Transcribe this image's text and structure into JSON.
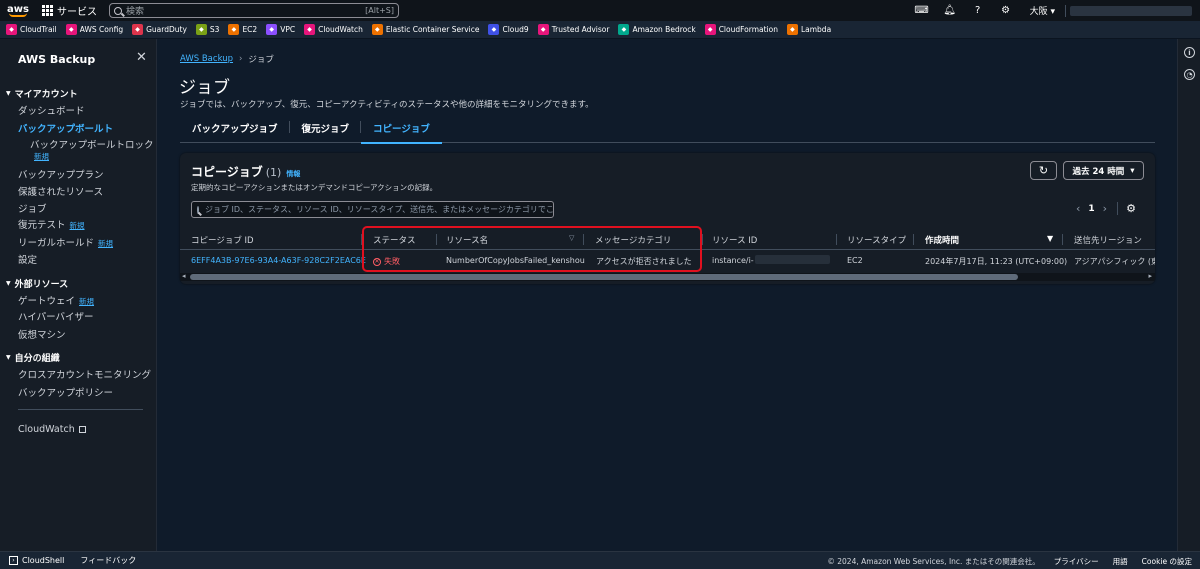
{
  "topnav": {
    "logo": "aws",
    "services_label": "サービス",
    "search_placeholder": "検索",
    "search_shortcut": "[Alt+S]",
    "region": "大阪 ▾"
  },
  "favorites": [
    {
      "label": "CloudTrail",
      "color": "#e7157b",
      "icon": "cloudtrail-icon"
    },
    {
      "label": "AWS Config",
      "color": "#e7157b",
      "icon": "config-icon"
    },
    {
      "label": "GuardDuty",
      "color": "#dd344c",
      "icon": "guardduty-icon"
    },
    {
      "label": "S3",
      "color": "#7aa116",
      "icon": "s3-icon"
    },
    {
      "label": "EC2",
      "color": "#ed7100",
      "icon": "ec2-icon"
    },
    {
      "label": "VPC",
      "color": "#8c4fff",
      "icon": "vpc-icon"
    },
    {
      "label": "CloudWatch",
      "color": "#e7157b",
      "icon": "cloudwatch-icon"
    },
    {
      "label": "Elastic Container Service",
      "color": "#ed7100",
      "icon": "ecs-icon"
    },
    {
      "label": "Cloud9",
      "color": "#3f51e6",
      "icon": "cloud9-icon"
    },
    {
      "label": "Trusted Advisor",
      "color": "#e7157b",
      "icon": "trusted-advisor-icon"
    },
    {
      "label": "Amazon Bedrock",
      "color": "#01a88d",
      "icon": "bedrock-icon"
    },
    {
      "label": "CloudFormation",
      "color": "#e7157b",
      "icon": "cloudformation-icon"
    },
    {
      "label": "Lambda",
      "color": "#ed7100",
      "icon": "lambda-icon"
    }
  ],
  "sidebar": {
    "title": "AWS Backup",
    "section_my_account": "マイアカウント",
    "dashboard": "ダッシュボード",
    "vaults": "バックアップボールト",
    "vault_lock": "バックアップボールトロック",
    "badge_new": "新規",
    "plans": "バックアッププラン",
    "protected": "保護されたリソース",
    "jobs": "ジョブ",
    "restore_test": "復元テスト",
    "legal_hold": "リーガルホールド",
    "settings": "設定",
    "section_external": "外部リソース",
    "gateway": "ゲートウェイ",
    "hypervisor": "ハイパーバイザー",
    "vms": "仮想マシン",
    "section_org": "自分の組織",
    "cross_account": "クロスアカウントモニタリング",
    "policies": "バックアップポリシー",
    "cloudwatch": "CloudWatch"
  },
  "breadcrumb": {
    "root": "AWS Backup",
    "current": "ジョブ"
  },
  "page": {
    "title": "ジョブ",
    "description": "ジョブでは、バックアップ、復元、コピーアクティビティのステータスや他の詳細をモニタリングできます。"
  },
  "tabs": [
    "バックアップジョブ",
    "復元ジョブ",
    "コピージョブ"
  ],
  "panel": {
    "title": "コピージョブ",
    "count": "(1)",
    "info": "情報",
    "description": "定期的なコピーアクションまたはオンデマンドコピーアクションの記録。",
    "range_label": "過去 24 時間",
    "filter_placeholder": "ジョブ ID、ステータス、リソース ID、リソースタイプ、送信先、またはメッセージカテゴリでこ",
    "page": "1"
  },
  "table": {
    "headers": [
      "コピージョブ ID",
      "ステータス",
      "リソース名",
      "メッセージカテゴリ",
      "リソース ID",
      "リソースタイプ",
      "作成時間",
      "送信先リージョン"
    ],
    "rows": [
      {
        "job_id": "6EFF4A3B-97E6-93A4-A63F-928C2F2EAC6E",
        "status": "失敗",
        "resource_name": "NumberOfCopyJobsFailed_kenshou",
        "message_category": "アクセスが拒否されました",
        "resource_id": "instance/i-",
        "resource_type": "EC2",
        "created": "2024年7月17日, 11:23 (UTC+09:00)",
        "destination": "アジアパシフィック (東"
      }
    ]
  },
  "footer": {
    "cloudshell": "CloudShell",
    "feedback": "フィードバック",
    "copyright": "© 2024, Amazon Web Services, Inc. またはその関連会社。",
    "privacy": "プライバシー",
    "terms": "用語",
    "cookie": "Cookie の設定"
  },
  "colors": {
    "accent": "#42b4ff",
    "error": "#ff5d64",
    "highlight": "#e0101f",
    "brand": "#ff9900"
  }
}
